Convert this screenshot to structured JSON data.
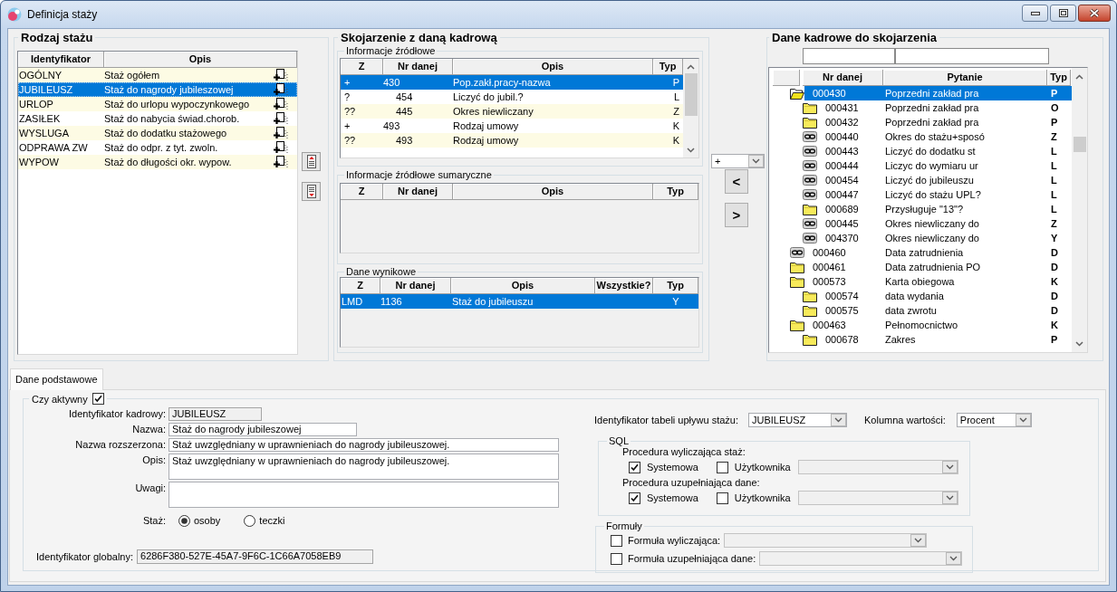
{
  "window": {
    "title": "Definicja staży"
  },
  "rodzaj_stazu": {
    "title": "Rodzaj stażu",
    "columns": [
      "Identyfikator",
      "Opis"
    ],
    "rows": [
      {
        "identyfikator": "OGÓLNY",
        "opis": "Staż ogółem",
        "selected": false
      },
      {
        "identyfikator": "JUBILEUSZ",
        "opis": "Staż do nagrody jubileszowej",
        "selected": true
      },
      {
        "identyfikator": "URLOP",
        "opis": "Staż do urlopu wypoczynkowego",
        "selected": false
      },
      {
        "identyfikator": "ZASIŁEK",
        "opis": "Staż do nabycia świad.chorob.",
        "selected": false
      },
      {
        "identyfikator": "WYSLUGA",
        "opis": "Staż do dodatku stażowego",
        "selected": false
      },
      {
        "identyfikator": "ODPRAWA ZW",
        "opis": "Staż do odpr. z tyt. zwoln.",
        "selected": false
      },
      {
        "identyfikator": "WYPOW",
        "opis": "Staż do długości okr. wypow.",
        "selected": false
      }
    ]
  },
  "skojarzenie": {
    "title": "Skojarzenie z daną kadrową",
    "zrodlowe": {
      "title": "Informacje źródłowe",
      "columns": [
        "Z",
        "Nr danej",
        "Opis",
        "Typ"
      ],
      "rows": [
        {
          "z": "+",
          "nr_danej": "430",
          "opis": "Pop.zakł.pracy-nazwa",
          "typ": "P",
          "selected": true,
          "children": [
            {
              "z": "?",
              "nr_danej": "454",
              "opis": "Liczyć do jubil.?",
              "typ": "L",
              "selected": false
            },
            {
              "z": "??",
              "nr_danej": "445",
              "opis": "Okres niewliczany",
              "typ": "Z",
              "selected": false
            }
          ]
        },
        {
          "z": "+",
          "nr_danej": "493",
          "opis": "Rodzaj umowy",
          "typ": "K",
          "selected": false,
          "children": [
            {
              "z": "??",
              "nr_danej": "493",
              "opis": "Rodzaj umowy",
              "typ": "K",
              "selected": false
            }
          ]
        }
      ]
    },
    "sumaryczne": {
      "title": "Informacje źródłowe sumaryczne",
      "columns": [
        "Z",
        "Nr danej",
        "Opis",
        "Typ"
      ]
    },
    "wynikowe": {
      "title": "Dane wynikowe",
      "columns": [
        "Z",
        "Nr danej",
        "Opis",
        "Wszystkie?",
        "Typ"
      ],
      "rows": [
        {
          "z": "LMD",
          "nr_danej": "1136",
          "opis": "Staż do jubileuszu",
          "typ": "Y",
          "selected": true
        }
      ]
    }
  },
  "transfer": {
    "mode": "+",
    "buttons": [
      "<",
      ">"
    ]
  },
  "dane_kadrowe": {
    "title": "Dane kadrowe do skojarzenia",
    "columns": [
      "Nr danej",
      "Pytanie",
      "Typ"
    ],
    "tree": [
      {
        "nr_danej": "000430",
        "pytanie": "Poprzedni zakład pra",
        "typ": "P",
        "kind": "folder",
        "selected": true,
        "children": [
          {
            "nr_danej": "000431",
            "pytanie": "Poprzedni zakład pra",
            "typ": "O",
            "kind": "folder",
            "selected": false
          },
          {
            "nr_danej": "000432",
            "pytanie": "Poprzedni zakład pra",
            "typ": "P",
            "kind": "folder",
            "selected": false
          },
          {
            "nr_danej": "000440",
            "pytanie": "Okres do stażu+sposó",
            "typ": "Z",
            "kind": "link",
            "selected": false
          },
          {
            "nr_danej": "000443",
            "pytanie": "Liczyć do dodatku st",
            "typ": "L",
            "kind": "link",
            "selected": false
          },
          {
            "nr_danej": "000444",
            "pytanie": "Liczyc do wymiaru ur",
            "typ": "L",
            "kind": "link",
            "selected": false
          },
          {
            "nr_danej": "000454",
            "pytanie": "Liczyć do jubileuszu",
            "typ": "L",
            "kind": "link",
            "selected": false
          },
          {
            "nr_danej": "000447",
            "pytanie": "Liczyć do stażu UPL?",
            "typ": "L",
            "kind": "link",
            "selected": false
          },
          {
            "nr_danej": "000689",
            "pytanie": "Przysługuje \"13\"?",
            "typ": "L",
            "kind": "folder",
            "selected": false
          },
          {
            "nr_danej": "000445",
            "pytanie": "Okres niewliczany do",
            "typ": "Z",
            "kind": "link",
            "selected": false
          },
          {
            "nr_danej": "004370",
            "pytanie": "Okres niewliczany do",
            "typ": "Y",
            "kind": "link",
            "selected": false
          }
        ]
      },
      {
        "nr_danej": "000460",
        "pytanie": "Data zatrudnienia",
        "typ": "D",
        "kind": "link",
        "selected": false
      },
      {
        "nr_danej": "000461",
        "pytanie": "Data zatrudnienia PO",
        "typ": "D",
        "kind": "folder",
        "selected": false
      },
      {
        "nr_danej": "000573",
        "pytanie": "Karta obiegowa",
        "typ": "K",
        "kind": "folder",
        "selected": false,
        "children": [
          {
            "nr_danej": "000574",
            "pytanie": "data wydania",
            "typ": "D",
            "kind": "folder",
            "selected": false
          },
          {
            "nr_danej": "000575",
            "pytanie": "data zwrotu",
            "typ": "D",
            "kind": "folder",
            "selected": false
          }
        ]
      },
      {
        "nr_danej": "000463",
        "pytanie": "Pełnomocnictwo",
        "typ": "K",
        "kind": "folder",
        "selected": false,
        "children": [
          {
            "nr_danej": "000678",
            "pytanie": "Zakres",
            "typ": "P",
            "kind": "folder",
            "selected": false
          }
        ]
      }
    ]
  },
  "tabs": [
    {
      "label": "Dane podstawowe",
      "selected": true
    }
  ],
  "form": {
    "active": {
      "label": "Czy aktywny",
      "checked": true
    },
    "fields": [
      {
        "label": "Identyfikator kadrowy:",
        "value": "JUBILEUSZ",
        "kind": "readonly"
      },
      {
        "label": "Nazwa:",
        "value": "Staż do nagrody jubileszowej",
        "kind": "text"
      },
      {
        "label": "Nazwa rozszerzona:",
        "value": "Staż uwzględniany w uprawnieniach do nagrody jubileuszowej.",
        "kind": "text"
      },
      {
        "label": "Opis:",
        "value": "Staż uwzględniany w uprawnieniach do nagrody jubileuszowej.",
        "kind": "memo"
      },
      {
        "label": "Uwagi:",
        "kind": "memo"
      }
    ],
    "staz": {
      "label": "Staż:",
      "options": [
        {
          "label": "osoby",
          "selected": true
        },
        {
          "label": "teczki",
          "selected": false
        }
      ]
    },
    "global_id": {
      "label": "Identyfikator globalny:",
      "value": "6286F380-527E-45A7-9F6C-1C66A7058EB9",
      "kind": "readonly"
    },
    "tabela_uplywu": {
      "label": "Identyfikator tabeli upływu stażu:",
      "value": "JUBILEUSZ"
    },
    "kolumna_wartosci": {
      "label": "Kolumna wartości:",
      "value": "Procent"
    },
    "sql": {
      "title": "SQL",
      "procedures": [
        {
          "label": "Procedura wyliczająca staż:",
          "options": [
            {
              "label": "Systemowa",
              "checked": true
            },
            {
              "label": "Użytkownika",
              "checked": false
            }
          ]
        },
        {
          "label": "Procedura uzupełniająca dane:",
          "options": [
            {
              "label": "Systemowa",
              "checked": true
            },
            {
              "label": "Użytkownika",
              "checked": false
            }
          ]
        }
      ]
    },
    "formuly": {
      "title": "Formuły",
      "items": [
        {
          "label": "Formuła wyliczająca:",
          "checked": false
        },
        {
          "label": "Formuła uzupełniająca dane:",
          "checked": false
        }
      ]
    }
  }
}
